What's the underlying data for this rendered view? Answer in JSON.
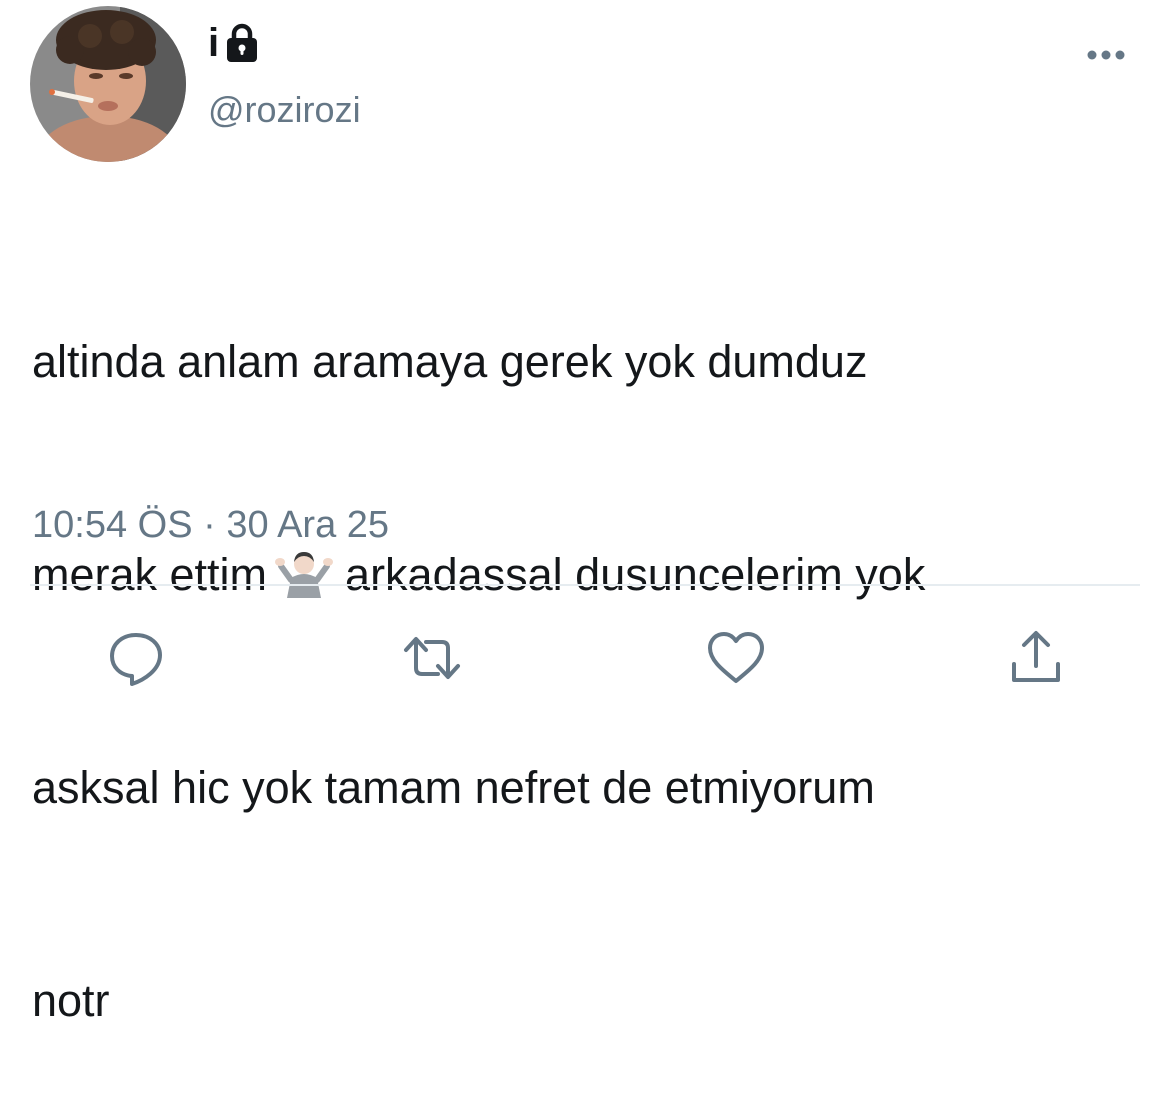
{
  "author": {
    "display_name": "i",
    "handle": "@rozirozi",
    "protected": true
  },
  "tweet": {
    "lines": [
      "altinda anlam aramaya gerek yok dumduz",
      "merak ettim",
      "arkadassal dusuncelerim yok",
      "asksal hic yok tamam nefret de etmiyorum",
      "notr"
    ],
    "emoji": "person-shrugging"
  },
  "meta": {
    "time": "10:54 ÖS",
    "separator": "·",
    "date": "30 Ara 25"
  },
  "actions": [
    "reply-icon",
    "retweet-icon",
    "like-icon",
    "share-icon"
  ],
  "colors": {
    "text": "#14171a",
    "secondary": "#657786",
    "divider": "#e6ecf0"
  }
}
